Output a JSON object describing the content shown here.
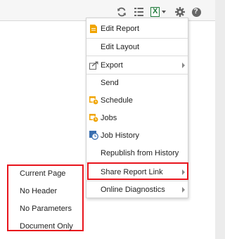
{
  "toolbar": {
    "icons": [
      "refresh-icon",
      "list-icon",
      "excel-icon",
      "gear-icon",
      "help-icon"
    ],
    "excel_letter": "X",
    "help_letter": "?"
  },
  "menu": {
    "items": [
      {
        "label": "Edit Report",
        "icon": "document-icon"
      },
      {
        "label": "Edit Layout",
        "icon": ""
      },
      {
        "label": "Export",
        "icon": "export-icon",
        "has_submenu": true
      },
      {
        "label": "Send",
        "icon": ""
      },
      {
        "label": "Schedule",
        "icon": "calendar-clock-icon"
      },
      {
        "label": "Jobs",
        "icon": "calendar-clock-icon"
      },
      {
        "label": "Job History",
        "icon": "history-icon"
      },
      {
        "label": "Republish from History",
        "icon": ""
      },
      {
        "label": "Share Report Link",
        "icon": "",
        "has_submenu": true,
        "highlighted": true
      },
      {
        "label": "Online Diagnostics",
        "icon": "",
        "has_submenu": true
      }
    ]
  },
  "submenu": {
    "items": [
      "Current Page",
      "No Header",
      "No Parameters",
      "Document Only"
    ]
  },
  "colors": {
    "highlight": "#e8141c",
    "excel_green": "#1f7a3a",
    "icon_orange": "#f0a400",
    "toolbar_gray": "#666666"
  }
}
